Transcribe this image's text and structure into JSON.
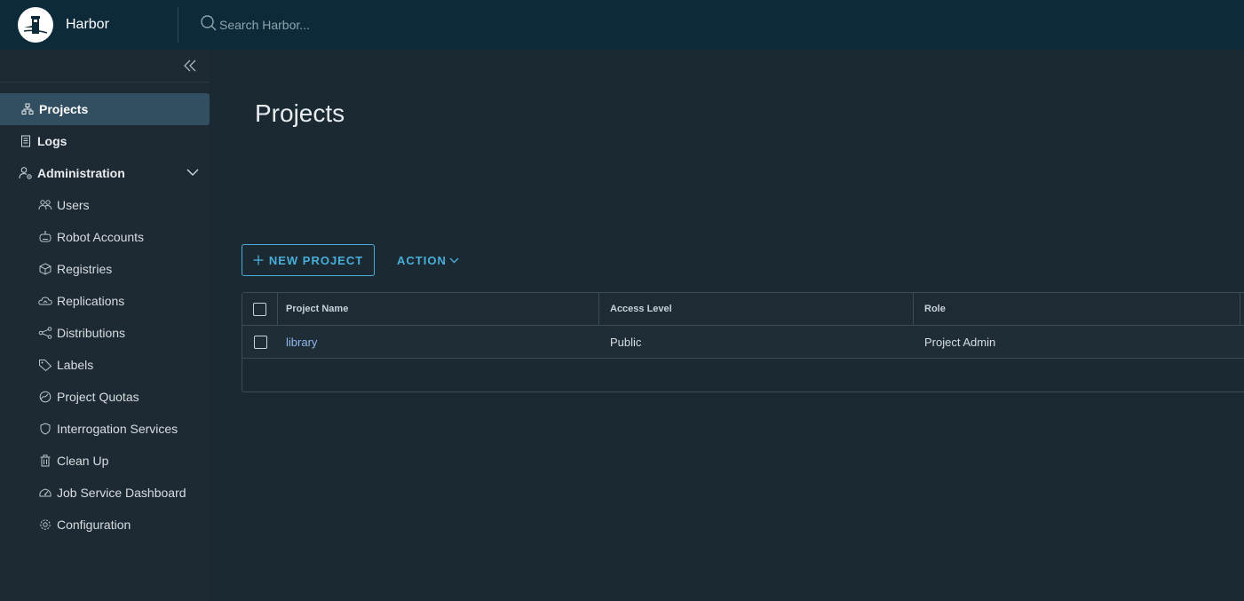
{
  "header": {
    "app_title": "Harbor",
    "search_placeholder": "Search Harbor..."
  },
  "sidebar": {
    "items": [
      {
        "label": "Projects",
        "icon": "projects-icon",
        "active": true
      },
      {
        "label": "Logs",
        "icon": "logs-icon"
      },
      {
        "label": "Administration",
        "icon": "administration-icon",
        "expanded": true
      }
    ],
    "admin_items": [
      {
        "label": "Users",
        "icon": "users-icon"
      },
      {
        "label": "Robot Accounts",
        "icon": "robot-icon"
      },
      {
        "label": "Registries",
        "icon": "registries-icon"
      },
      {
        "label": "Replications",
        "icon": "replications-icon"
      },
      {
        "label": "Distributions",
        "icon": "distributions-icon"
      },
      {
        "label": "Labels",
        "icon": "labels-icon"
      },
      {
        "label": "Project Quotas",
        "icon": "quotas-icon"
      },
      {
        "label": "Interrogation Services",
        "icon": "shield-icon"
      },
      {
        "label": "Clean Up",
        "icon": "trash-icon"
      },
      {
        "label": "Job Service Dashboard",
        "icon": "dashboard-icon"
      },
      {
        "label": "Configuration",
        "icon": "gear-icon"
      }
    ]
  },
  "main": {
    "title": "Projects",
    "new_project_label": "NEW PROJECT",
    "action_label": "ACTION",
    "table": {
      "columns": [
        "Project Name",
        "Access Level",
        "Role"
      ],
      "rows": [
        [
          "library",
          "Public",
          "Project Admin"
        ]
      ]
    }
  },
  "colors": {
    "header_bg": "#0c2a3a",
    "sidebar_bg": "#1e2a33",
    "main_bg": "#1b2a32",
    "accent": "#49afd9",
    "link": "#8fb8ef",
    "active_item_bg": "#324f62"
  }
}
